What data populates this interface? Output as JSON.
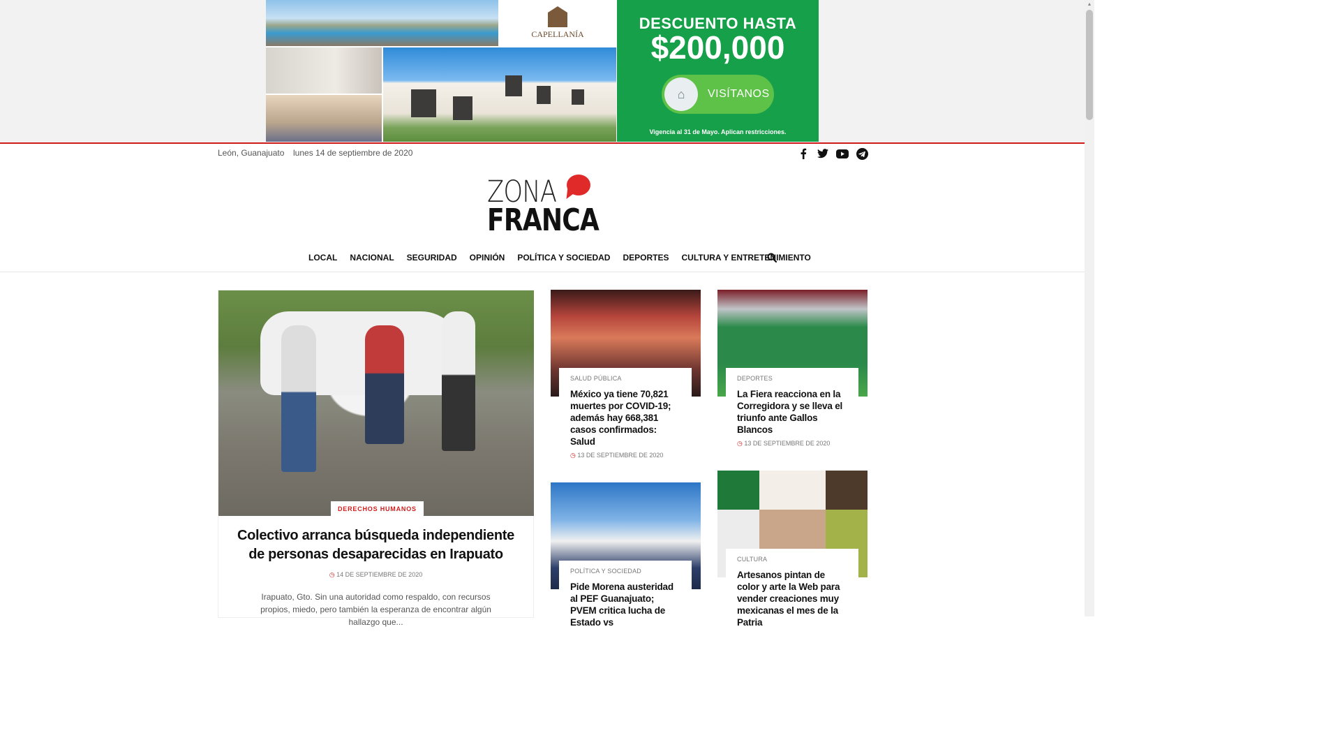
{
  "ad": {
    "brand": "CAPELLANÍA",
    "headline_1": "DESCUENTO HASTA",
    "headline_2": "$200,000",
    "cta_label": "VISÍTANOS",
    "fine_print": "Vigencia al 31 de Mayo. Aplican restricciones.",
    "accent_color": "#17a04a"
  },
  "topbar": {
    "location": "León, Guanajuato",
    "date": "lunes 14 de septiembre de 2020",
    "social_icons": [
      "facebook-icon",
      "twitter-icon",
      "youtube-icon",
      "telegram-icon"
    ]
  },
  "logo": {
    "line1": "ZONA",
    "line2": "FRANCA",
    "accent_color": "#e02a2a"
  },
  "nav": {
    "items": [
      "LOCAL",
      "NACIONAL",
      "SEGURIDAD",
      "OPINIÓN",
      "POLÍTICA Y SOCIEDAD",
      "DEPORTES",
      "CULTURA Y ENTRETENIMIENTO"
    ]
  },
  "featured": {
    "category": "DERECHOS HUMANOS",
    "title": "Colectivo arranca búsqueda independiente de personas desaparecidas en Irapuato",
    "date": "14 DE SEPTIEMBRE DE 2020",
    "excerpt": "Irapuato, Gto.  Sin una autoridad como respaldo, con recursos propios, miedo, pero también la esperanza de encontrar algún hallazgo que..."
  },
  "cards": [
    {
      "category": "SALUD PÚBLICA",
      "title": "México ya tiene 70,821 muertes por COVID-19; además hay 668,381 casos confirmados: Salud",
      "date": "13 DE SEPTIEMBRE DE 2020"
    },
    {
      "category": "DEPORTES",
      "title": "La Fiera reacciona en la Corregidora y se lleva el triunfo ante Gallos Blancos",
      "date": "13 DE SEPTIEMBRE DE 2020"
    },
    {
      "category": "POLÍTICA Y SOCIEDAD",
      "title": "Pide Morena austeridad al PEF Guanajuato; PVEM critica lucha de Estado vs",
      "date": ""
    },
    {
      "category": "CULTURA",
      "title": "Artesanos pintan de color y arte la Web para vender creaciones muy mexicanas el mes de la Patria",
      "date": ""
    }
  ],
  "colors": {
    "red": "#d11b1b"
  }
}
